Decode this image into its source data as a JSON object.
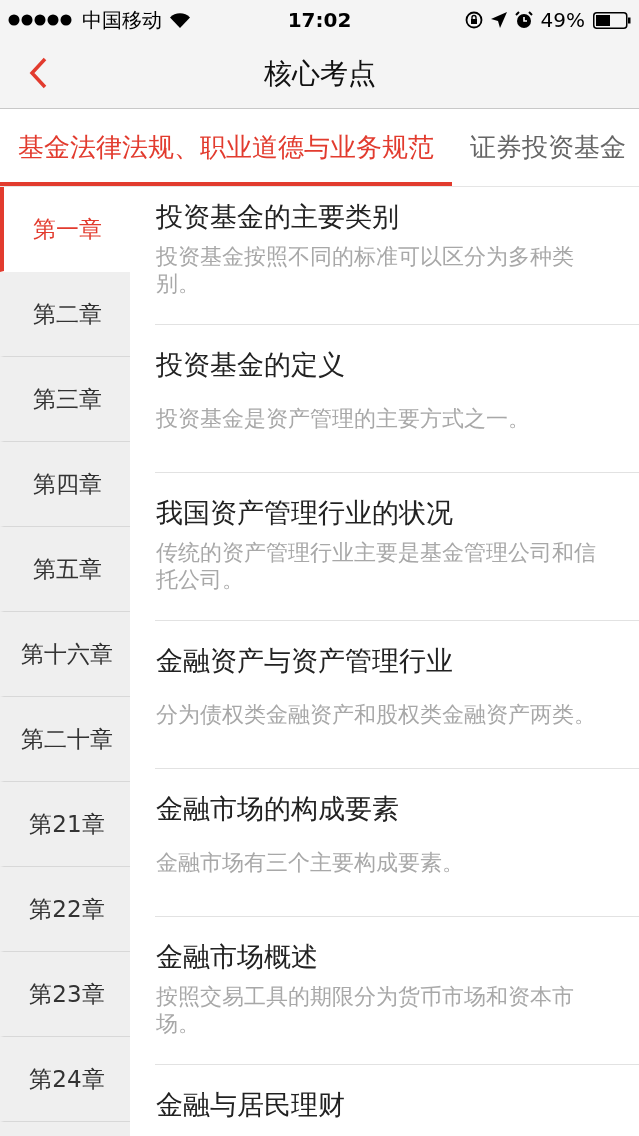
{
  "status_bar": {
    "carrier": "中国移动",
    "time": "17:02",
    "battery": "49%"
  },
  "nav": {
    "title": "核心考点"
  },
  "tabs": [
    {
      "label": "基金法律法规、职业道德与业务规范",
      "selected": true
    },
    {
      "label": "证券投资基金",
      "selected": false
    }
  ],
  "chapters": [
    {
      "label": "第一章",
      "selected": true
    },
    {
      "label": "第二章",
      "selected": false
    },
    {
      "label": "第三章",
      "selected": false
    },
    {
      "label": "第四章",
      "selected": false
    },
    {
      "label": "第五章",
      "selected": false
    },
    {
      "label": "第十六章",
      "selected": false
    },
    {
      "label": "第二十章",
      "selected": false
    },
    {
      "label": "第21章",
      "selected": false
    },
    {
      "label": "第22章",
      "selected": false
    },
    {
      "label": "第23章",
      "selected": false
    },
    {
      "label": "第24章",
      "selected": false
    }
  ],
  "points": [
    {
      "title": "投资基金的主要类别",
      "summary": "投资基金按照不同的标准可以区分为多种类别。"
    },
    {
      "title": "投资基金的定义",
      "summary": "投资基金是资产管理的主要方式之一。"
    },
    {
      "title": "我国资产管理行业的状况",
      "summary": "传统的资产管理行业主要是基金管理公司和信托公司。"
    },
    {
      "title": "金融资产与资产管理行业",
      "summary": "分为债权类金融资产和股权类金融资产两类。"
    },
    {
      "title": "金融市场的构成要素",
      "summary": "金融市场有三个主要构成要素。"
    },
    {
      "title": "金融市场概述",
      "summary": "按照交易工具的期限分为货币市场和资本市场。"
    },
    {
      "title": "金融与居民理财"
    }
  ]
}
